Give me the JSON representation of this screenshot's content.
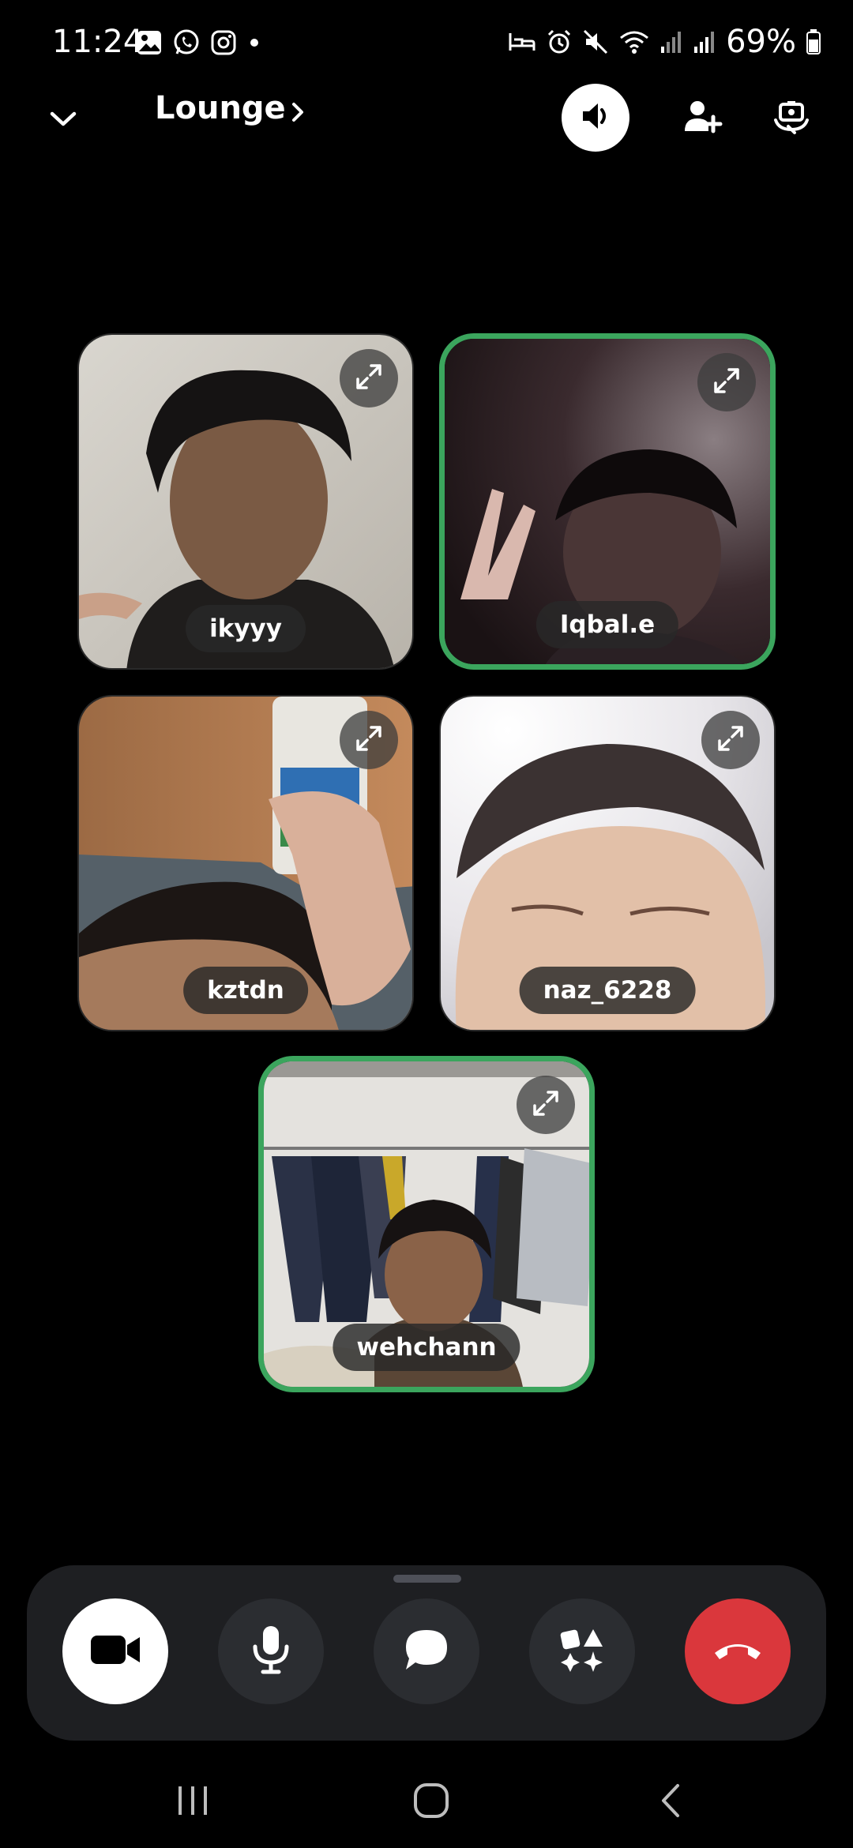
{
  "status_bar": {
    "time": "11:24",
    "battery": "69%",
    "left_icons": [
      "gallery-icon",
      "whatsapp-icon",
      "instagram-icon",
      "dot-icon"
    ],
    "right_icons": [
      "bed-icon",
      "alarm-icon",
      "mute-icon",
      "wifi-icon",
      "signal-icon",
      "signal-icon",
      "battery-icon"
    ]
  },
  "header": {
    "channel_name": "Lounge",
    "icons": [
      "chevron-down-icon",
      "chevron-right-icon",
      "speaker-icon",
      "add-user-icon",
      "switch-camera-icon"
    ]
  },
  "participants": [
    {
      "name": "ikyyy",
      "speaking": false
    },
    {
      "name": "Iqbal.e",
      "speaking": true
    },
    {
      "name": "kztdn",
      "speaking": false
    },
    {
      "name": "naz_6228",
      "speaking": false
    },
    {
      "name": "wehchann",
      "speaking": true
    }
  ],
  "controls": [
    "camera-icon",
    "microphone-icon",
    "chat-icon",
    "activities-icon",
    "end-call-icon"
  ],
  "colors": {
    "background": "#000000",
    "speaking_border": "#3ba55d",
    "panel": "#1e1f22",
    "button": "#2b2d31",
    "end_call": "#da373c"
  },
  "nav_bar": [
    "recents-icon",
    "home-icon",
    "back-icon"
  ]
}
